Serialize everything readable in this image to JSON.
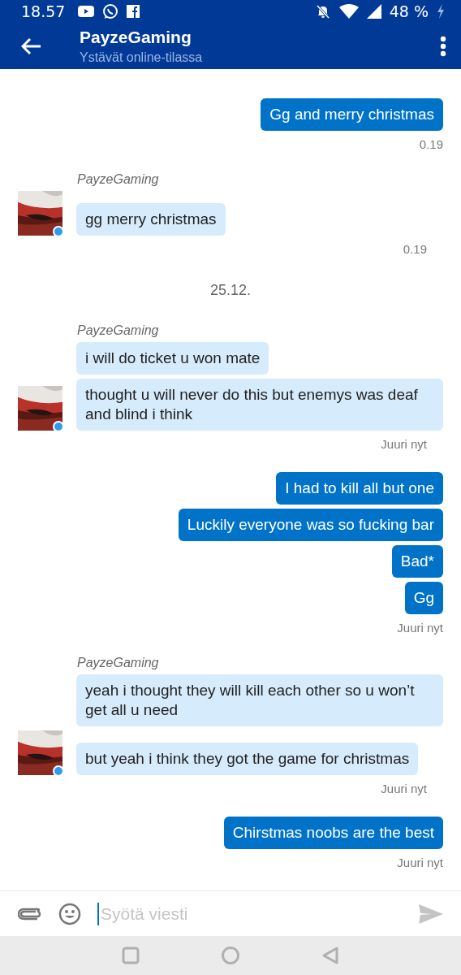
{
  "status_bar": {
    "time": "18.57",
    "battery": "48 %"
  },
  "header": {
    "title": "PayzeGaming",
    "subtitle": "Ystävät online-tilassa"
  },
  "thread": [
    {
      "kind": "sent",
      "messages": [
        "Gg and merry christmas"
      ],
      "time": "0.19"
    },
    {
      "kind": "received",
      "sender": "PayzeGaming",
      "online": true,
      "messages": [
        "gg merry christmas"
      ],
      "time": "0.19"
    },
    {
      "kind": "date",
      "text": "25.12."
    },
    {
      "kind": "received",
      "sender": "PayzeGaming",
      "online": true,
      "messages": [
        "i will do ticket u won mate",
        "thought u will never do this but enemys was deaf and blind i think"
      ],
      "time": "Juuri nyt"
    },
    {
      "kind": "sent",
      "messages": [
        "I had to kill all but one",
        "Luckily everyone was so fucking bar",
        "Bad*",
        "Gg"
      ],
      "time": "Juuri nyt"
    },
    {
      "kind": "received",
      "sender": "PayzeGaming",
      "online": true,
      "messages": [
        "yeah i thought they will kill each other so u won’t get all u need",
        "but yeah i think they got the game for christmas"
      ],
      "time": "Juuri nyt"
    },
    {
      "kind": "sent",
      "messages": [
        "Chirstmas noobs are the best"
      ],
      "time": "Juuri nyt"
    }
  ],
  "composer": {
    "placeholder": "Syötä viesti"
  }
}
